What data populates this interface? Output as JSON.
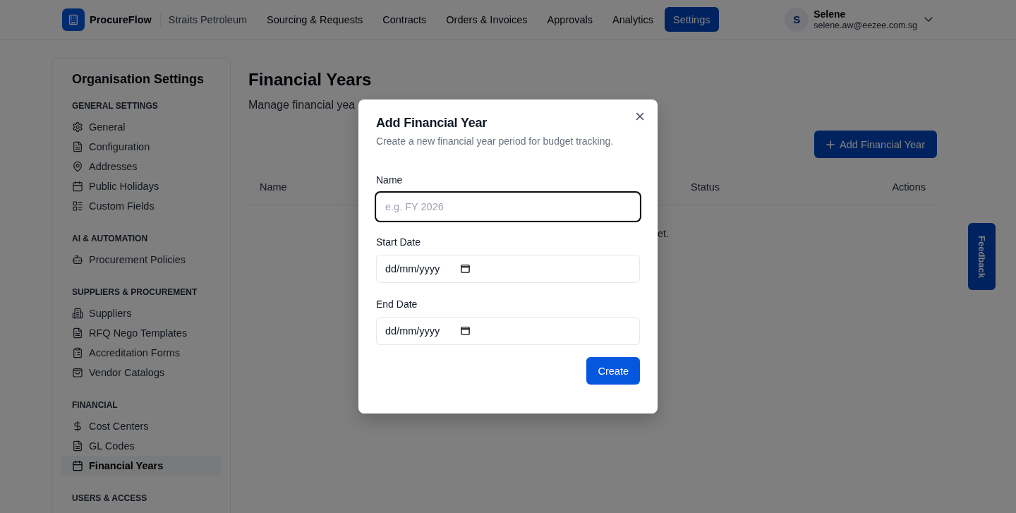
{
  "header": {
    "app_name": "ProcureFlow",
    "organisation": "Straits Petroleum",
    "nav": [
      {
        "label": "Sourcing & Requests",
        "selected": false
      },
      {
        "label": "Contracts",
        "selected": false
      },
      {
        "label": "Orders & Invoices",
        "selected": false
      },
      {
        "label": "Approvals",
        "selected": false
      },
      {
        "label": "Analytics",
        "selected": false
      },
      {
        "label": "Settings",
        "selected": true
      }
    ],
    "user": {
      "initial": "S",
      "name": "Selene",
      "email": "selene.aw@eezee.com.sg"
    }
  },
  "sidebar": {
    "title": "Organisation Settings",
    "sections": [
      {
        "heading": "GENERAL SETTINGS",
        "items": [
          {
            "label": "General",
            "selected": false
          },
          {
            "label": "Configuration",
            "selected": false
          },
          {
            "label": "Addresses",
            "selected": false
          },
          {
            "label": "Public Holidays",
            "selected": false
          },
          {
            "label": "Custom Fields",
            "selected": false
          }
        ]
      },
      {
        "heading": "AI & AUTOMATION",
        "items": [
          {
            "label": "Procurement Policies",
            "selected": false
          }
        ]
      },
      {
        "heading": "SUPPLIERS & PROCUREMENT",
        "items": [
          {
            "label": "Suppliers",
            "selected": false
          },
          {
            "label": "RFQ Nego Templates",
            "selected": false
          },
          {
            "label": "Accreditation Forms",
            "selected": false
          },
          {
            "label": "Vendor Catalogs",
            "selected": false
          }
        ]
      },
      {
        "heading": "FINANCIAL",
        "items": [
          {
            "label": "Cost Centers",
            "selected": false
          },
          {
            "label": "GL Codes",
            "selected": false
          },
          {
            "label": "Financial Years",
            "selected": true
          }
        ]
      },
      {
        "heading": "USERS & ACCESS"
      }
    ]
  },
  "page": {
    "title": "Financial Years",
    "subtitle": "Manage financial yea",
    "add_button": "Add Financial Year",
    "table": {
      "columns": [
        "Name",
        "Status",
        "Actions"
      ],
      "empty_text": "et."
    }
  },
  "feedback_tab": "Feedback",
  "modal": {
    "title": "Add Financial Year",
    "description": "Create a new financial year period for budget tracking.",
    "fields": [
      {
        "kind": "text",
        "label": "Name",
        "placeholder": "e.g. FY 2026",
        "focused": true
      },
      {
        "kind": "date",
        "label": "Start Date",
        "placeholder": "dd/mm/yyyy",
        "focused": false
      },
      {
        "kind": "date",
        "label": "End Date",
        "placeholder": "dd/mm/yyyy",
        "focused": false
      }
    ],
    "submit": "Create"
  }
}
